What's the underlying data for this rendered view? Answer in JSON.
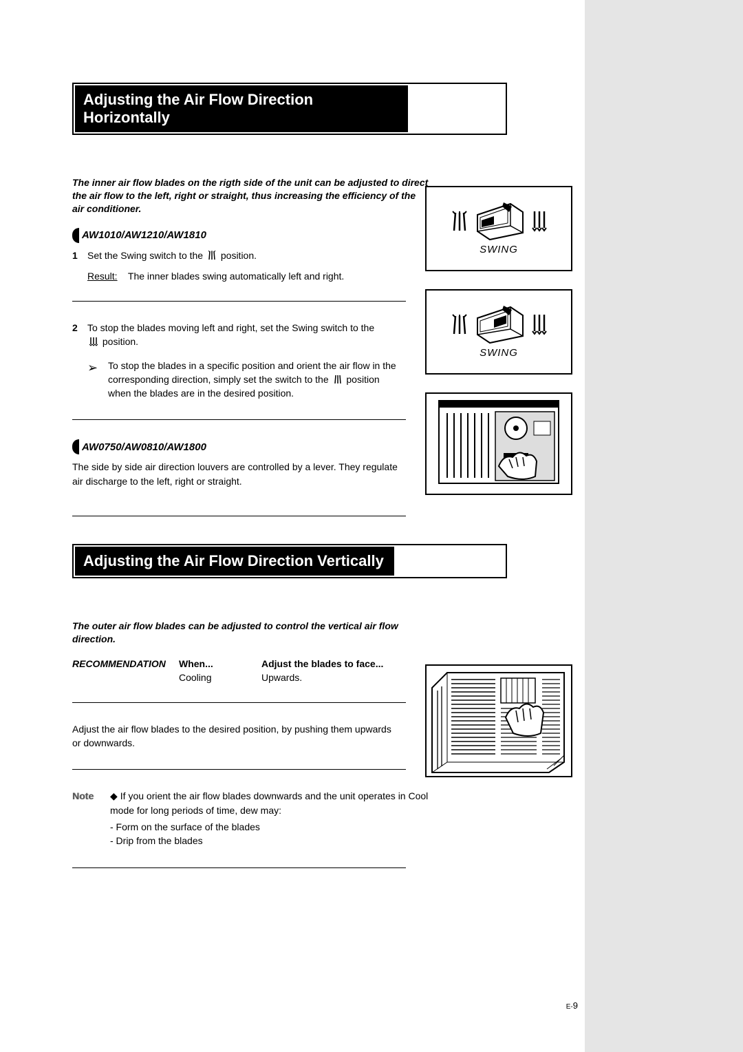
{
  "section1": {
    "title": "Adjusting the Air Flow Direction Horizontally",
    "intro": "The inner air flow blades on the rigth side of the unit can be adjusted to direct the air flow to the left, right or straight, thus increasing the efficiency of the air conditioner.",
    "models_a": "AW1010/AW1210/AW1810",
    "step1_num": "1",
    "step1_text_a": "Set the Swing switch to the",
    "step1_text_b": "position.",
    "result_label": "Result:",
    "result_text": "The inner blades swing automatically left and right.",
    "step2_num": "2",
    "step2_text_a": "To stop the blades moving left and right, set the Swing switch to the",
    "step2_text_b": "position.",
    "tip_text_a": "To stop the blades in a specific position and orient the air flow in the corresponding direction, simply set the switch to the",
    "tip_text_b": "position when the blades are in the desired position.",
    "models_b": "AW0750/AW0810/AW1800",
    "models_b_text": "The side by side air direction louvers are controlled by a lever. They regulate air discharge to the left, right or straight.",
    "swing": "SWING"
  },
  "section2": {
    "title": "Adjusting the Air Flow Direction Vertically",
    "intro": "The outer air flow blades can be adjusted to control the vertical air flow direction.",
    "rec_label": "RECOMMENDATION",
    "when_header": "When...",
    "adjust_header": "Adjust the blades to face...",
    "when_val": "Cooling",
    "adjust_val": "Upwards.",
    "adjust_text": "Adjust the air flow blades to the desired position, by pushing them upwards or downwards.",
    "note_label": "Note",
    "note_text": "If you orient the air flow blades downwards and the unit operates in Cool mode for long periods of time, dew may:",
    "note_bullet1": "- Form on the surface of the blades",
    "note_bullet2": "- Drip from the blades"
  },
  "page_num_prefix": "E-",
  "page_num": "9"
}
